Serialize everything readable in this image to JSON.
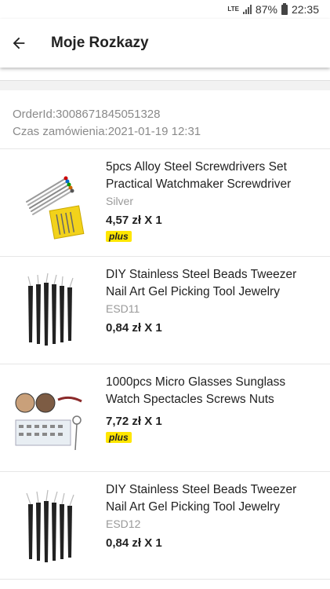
{
  "status_bar": {
    "network": "LTE",
    "battery": "87%",
    "time": "22:35"
  },
  "header": {
    "title": "Moje Rozkazy"
  },
  "order": {
    "id_line": "OrderId:3008671845051328",
    "date_line": "Czas zamówienia:2021-01-19 12:31"
  },
  "items": [
    {
      "name": "5pcs Alloy Steel Screwdrivers Set Practical Watchmaker Screwdriver Cutter Hand Tool Kit For Repair Watch",
      "variant": "Silver",
      "price": "4,57 zł X 1",
      "badge": "plus"
    },
    {
      "name": "DIY Stainless Steel Beads Tweezer Nail Art Gel Picking Tool Jewelry Portable ESD",
      "variant": "ESD11",
      "price": "0,84 zł X 1",
      "badge": ""
    },
    {
      "name": "1000pcs Micro Glasses Sunglass Watch Spectacles Screws Nuts Screwdriver Repair Tool Kit",
      "variant": "",
      "price": "7,72 zł X 1",
      "badge": "plus"
    },
    {
      "name": "DIY Stainless Steel Beads Tweezer Nail Art Gel Picking Tool Jewelry Portable ESD",
      "variant": "ESD12",
      "price": "0,84 zł X 1",
      "badge": ""
    }
  ]
}
